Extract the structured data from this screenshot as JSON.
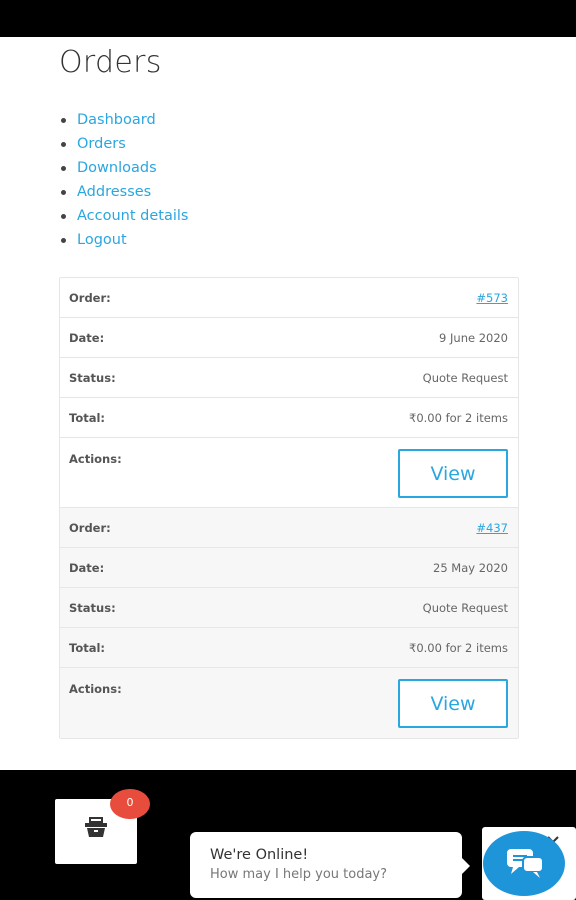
{
  "page": {
    "title": "Orders"
  },
  "nav": {
    "items": [
      {
        "label": "Dashboard"
      },
      {
        "label": "Orders"
      },
      {
        "label": "Downloads"
      },
      {
        "label": "Addresses"
      },
      {
        "label": "Account details"
      },
      {
        "label": "Logout"
      }
    ]
  },
  "table": {
    "labels": {
      "order": "Order:",
      "date": "Date:",
      "status": "Status:",
      "total": "Total:",
      "actions": "Actions:"
    },
    "orders": [
      {
        "number": "#573",
        "date": "9 June 2020",
        "status": "Quote Request",
        "total": "₹0.00 for 2 items",
        "action_label": "View"
      },
      {
        "number": "#437",
        "date": "25 May 2020",
        "status": "Quote Request",
        "total": "₹0.00 for 2 items",
        "action_label": "View"
      }
    ]
  },
  "cart": {
    "count": "0",
    "icon": "basket-icon"
  },
  "chat": {
    "title": "We're Online!",
    "subtitle": "How may I help you today?",
    "launcher_icon": "chat-bubbles-icon",
    "close_icon": "close-icon"
  },
  "colors": {
    "link": "#2aa6e0",
    "badge": "#e74c3c",
    "chat_button": "#1e95d9"
  }
}
